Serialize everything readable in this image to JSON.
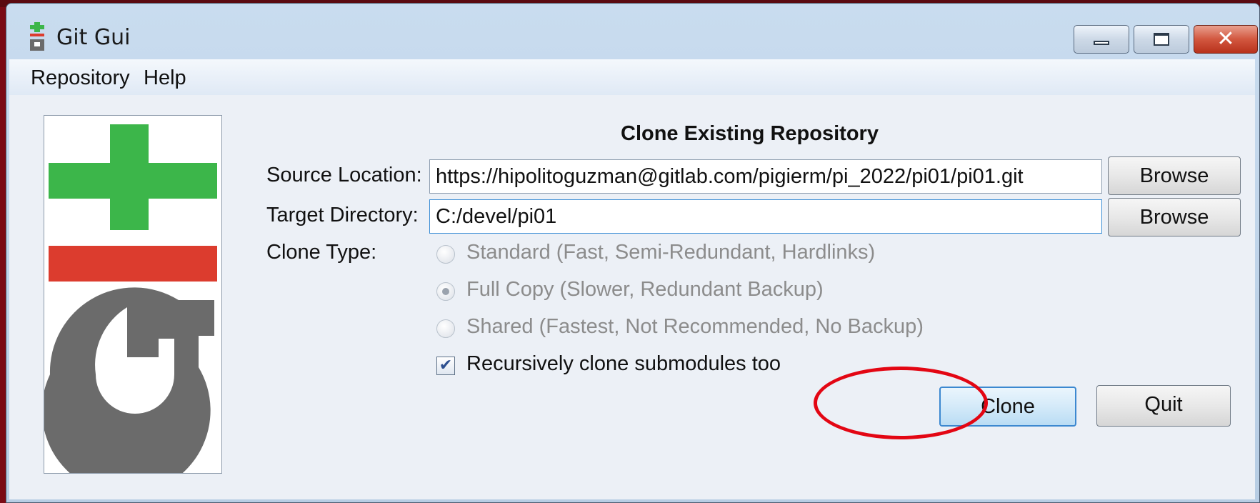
{
  "window": {
    "title": "Git Gui"
  },
  "menu": {
    "items": [
      "Repository",
      "Help"
    ]
  },
  "clone": {
    "heading": "Clone Existing Repository",
    "source_label": "Source Location:",
    "source_value": "https://hipolitoguzman@gitlab.com/pigierm/pi_2022/pi01/pi01.git",
    "target_label": "Target Directory:",
    "target_value": "C:/devel/pi01",
    "browse_label": "Browse",
    "clone_type_label": "Clone Type:",
    "options": [
      {
        "label": "Standard (Fast, Semi-Redundant, Hardlinks)",
        "selected": false
      },
      {
        "label": "Full Copy (Slower, Redundant Backup)",
        "selected": true
      },
      {
        "label": "Shared (Fastest, Not Recommended, No Backup)",
        "selected": false
      }
    ],
    "recursive_label": "Recursively clone submodules too",
    "recursive_checked": true,
    "clone_button": "Clone",
    "quit_button": "Quit"
  },
  "icons": [
    "git-gui-app-icon",
    "minimize-icon",
    "maximize-icon",
    "close-icon",
    "git-logo",
    "check-icon"
  ],
  "colors": {
    "logo_green": "#3cb64a",
    "logo_red": "#dc3c2e",
    "logo_gray": "#6b6b6b",
    "annotation_red": "#e30613"
  }
}
